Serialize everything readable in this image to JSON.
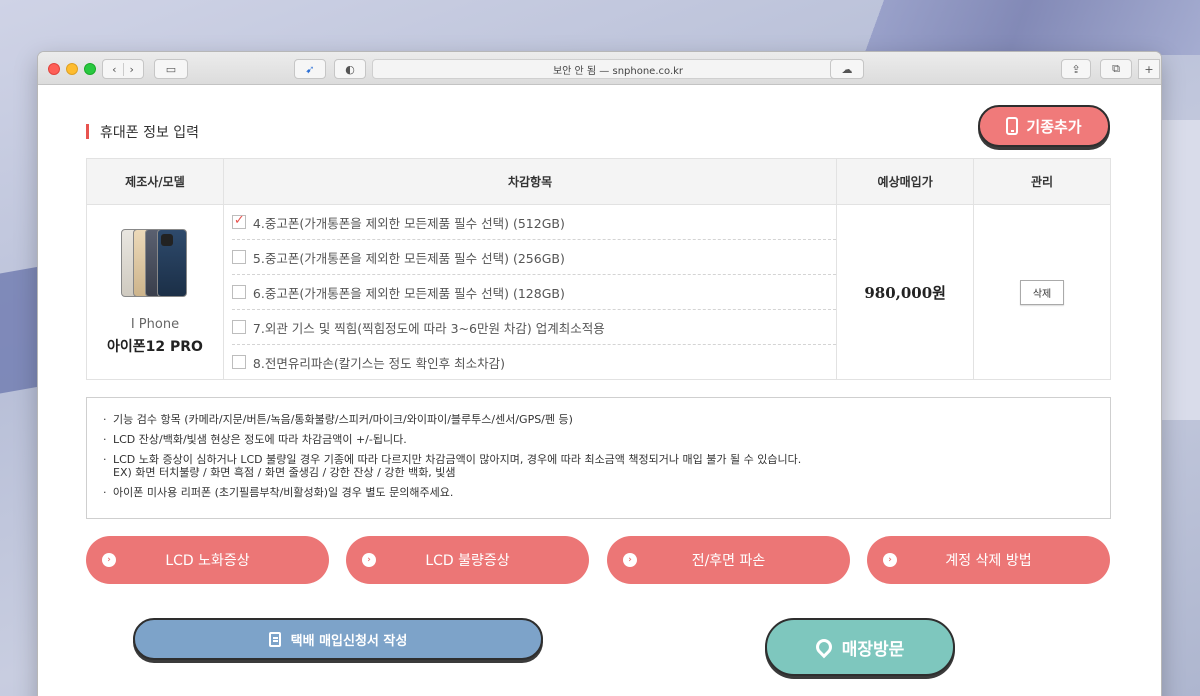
{
  "browser": {
    "address": "보안 안 됨 — snphone.co.kr"
  },
  "section_title": "휴대폰 정보 입력",
  "add_button": "기종추가",
  "table": {
    "headers": [
      "제조사/모델",
      "차감항목",
      "예상매입가",
      "관리"
    ],
    "model": {
      "maker": "I Phone",
      "name": "아이폰12 PRO"
    },
    "items": [
      {
        "label": "4.중고폰(가개통폰을 제외한 모든제품 필수 선택) (512GB)",
        "checked": true
      },
      {
        "label": "5.중고폰(가개통폰을 제외한 모든제품 필수 선택) (256GB)",
        "checked": false
      },
      {
        "label": "6.중고폰(가개통폰을 제외한 모든제품 필수 선택) (128GB)",
        "checked": false
      },
      {
        "label": "7.외관 기스 및 찍힘(찍힘정도에 따라 3~6만원 차감) 업계최소적용",
        "checked": false
      },
      {
        "label": "8.전면유리파손(칼기스는 정도 확인후 최소차감)",
        "checked": false
      }
    ],
    "price": "980,000원",
    "delete_label": "삭제"
  },
  "notices": [
    "기능 검수 항목 (카메라/지문/버튼/녹음/통화불량/스피커/마이크/와이파이/블루투스/센서/GPS/펜 등)",
    "LCD 잔상/백화/빛샘 현상은 정도에 따라 차감금액이 +/-됩니다.",
    "LCD 노화 증상이 심하거나 LCD 불량일 경우 기종에 따라 다르지만 차감금액이 많아지며, 경우에 따라 최소금액 책정되거나 매입 불가 될 수 있습니다.",
    "EX) 화면 터치불량 / 화면 흑점 / 화면 줄생김 / 강한 잔상 / 강한 백화, 빛샘",
    "아이폰 미사용 리퍼폰 (초기필름부착/비활성화)일 경우 별도 문의해주세요."
  ],
  "info_buttons": [
    "LCD 노화증상",
    "LCD 불량증상",
    "전/후면 파손",
    "계정 삭제 방법"
  ],
  "delivery_button": "택배 매입신청서 작성",
  "visit_button": "매장방문"
}
